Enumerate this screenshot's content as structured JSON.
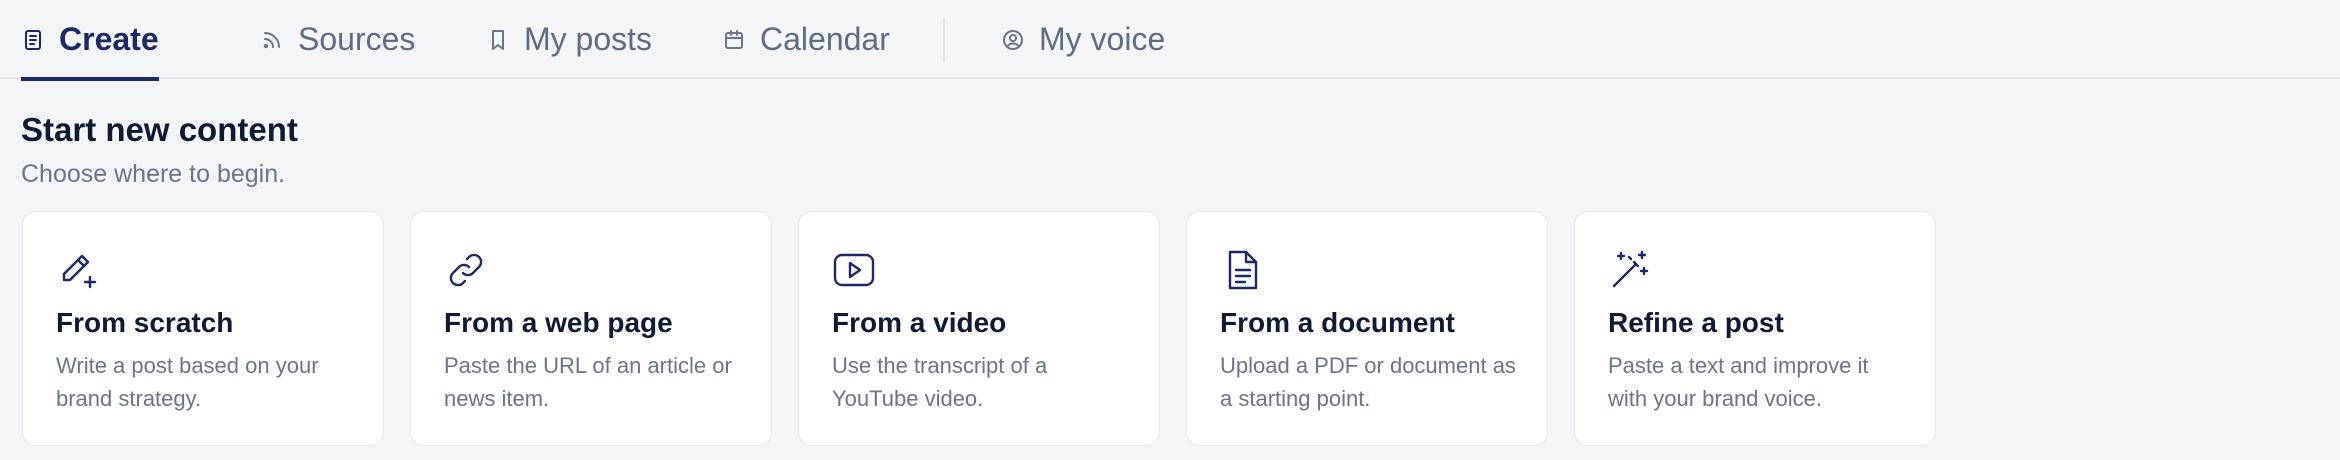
{
  "tabs": [
    {
      "label": "Create",
      "icon": "document-icon",
      "active": true
    },
    {
      "label": "Sources",
      "icon": "rss-icon"
    },
    {
      "label": "My posts",
      "icon": "bookmark-icon"
    },
    {
      "label": "Calendar",
      "icon": "calendar-icon"
    },
    {
      "label": "My voice",
      "icon": "user-circle-icon"
    }
  ],
  "section": {
    "title": "Start new content",
    "subtitle": "Choose where to begin."
  },
  "cards": [
    {
      "title": "From scratch",
      "description": "Write a post based on your brand strategy.",
      "icon": "pencil-plus-icon"
    },
    {
      "title": "From a web page",
      "description": "Paste the URL of an article or news item.",
      "icon": "link-icon"
    },
    {
      "title": "From a video",
      "description": "Use the transcript of a YouTube video.",
      "icon": "video-play-icon"
    },
    {
      "title": "From a document",
      "description": "Upload a PDF or document as a starting point.",
      "icon": "file-text-icon"
    },
    {
      "title": "Refine a post",
      "description": "Paste a text and improve it with your brand voice.",
      "icon": "magic-wand-icon"
    }
  ],
  "colors": {
    "accent": "#1b2a63",
    "background": "#f4f5f7",
    "card": "#ffffff",
    "muted_text": "#6b7589"
  }
}
